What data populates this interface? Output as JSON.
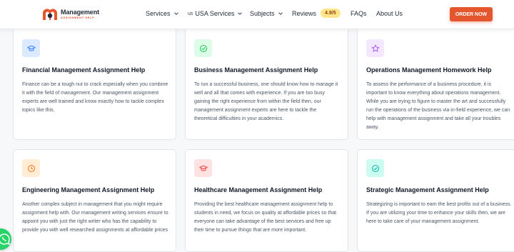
{
  "brand": {
    "title": "Management",
    "subtitle": "ASSIGNMENT HELP",
    "logo_color": "#e4572e"
  },
  "nav": {
    "services": "Services",
    "usa_flag": "us",
    "usa_services": "USA Services",
    "subjects": "Subjects",
    "reviews": "Reviews",
    "rating": "4.9/5",
    "faqs": "FAQs",
    "about": "About Us",
    "order_button": "ORDER NOW"
  },
  "cards": [
    {
      "title": "Financial Management Assignment Help",
      "description": "Finance can be a tough nut to crack especially when you combine it with the field of management. Our management assignment experts are well trained and know exactly how to tackle complex topics like this.",
      "icon": "graduation-cap-icon",
      "icon_color": "#3b82f6",
      "icon_bg": "#dbeafe"
    },
    {
      "title": "Business Management Assignment Help",
      "description": "To run a successful business, one should know how to manage it well and all that comes with experience. If you are too busy gaining the right experience from within the field then, our management assignment experts are here to tackle the theoretical difficulties in your academics.",
      "icon": "check-circle-icon",
      "icon_color": "#22c55e",
      "icon_bg": "#dcfce7"
    },
    {
      "title": "Operations Management Homework Help",
      "description": "To assess the performance of a business procedure, it is important to know everything about operations management. While you are trying to figure to master the art and successfully run the operations of the business via in-field experience, we can help with management assignment and take all your troubles away.",
      "icon": "star-icon",
      "icon_color": "#a855f7",
      "icon_bg": "#f3e8ff"
    },
    {
      "title": "Engineering Management Assignment Help",
      "description": "Another complex subject in management that you might require assignment help with. Our management writing services ensure to appoint you with just the right writer who has the capability to provide you with well researched assignments at affordable prices",
      "icon": "clock-icon",
      "icon_color": "#f97316",
      "icon_bg": "#ffedd5"
    },
    {
      "title": "Healthcare Management Assignment Help",
      "description": "Providing the best healthcare management assignment help to students in need, we focus on quality at affordable prices so that everyone can take advantage of the best services and free up their time to pursue things that are more important.",
      "icon": "graduation-cap-icon",
      "icon_color": "#ef4444",
      "icon_bg": "#fee2e2"
    },
    {
      "title": "Strategic Management Assignment Help",
      "description": "Strategizing is important to earn the best profits out of a business. If you are utilizing your time to enhance your skills then, we are here to take care of your management assignment.",
      "icon": "check-circle-icon",
      "icon_color": "#14b8a6",
      "icon_bg": "#ccfbf1"
    }
  ],
  "floating": {
    "whatsapp_icon": "whatsapp-icon",
    "whatsapp_color": "#25d366"
  }
}
